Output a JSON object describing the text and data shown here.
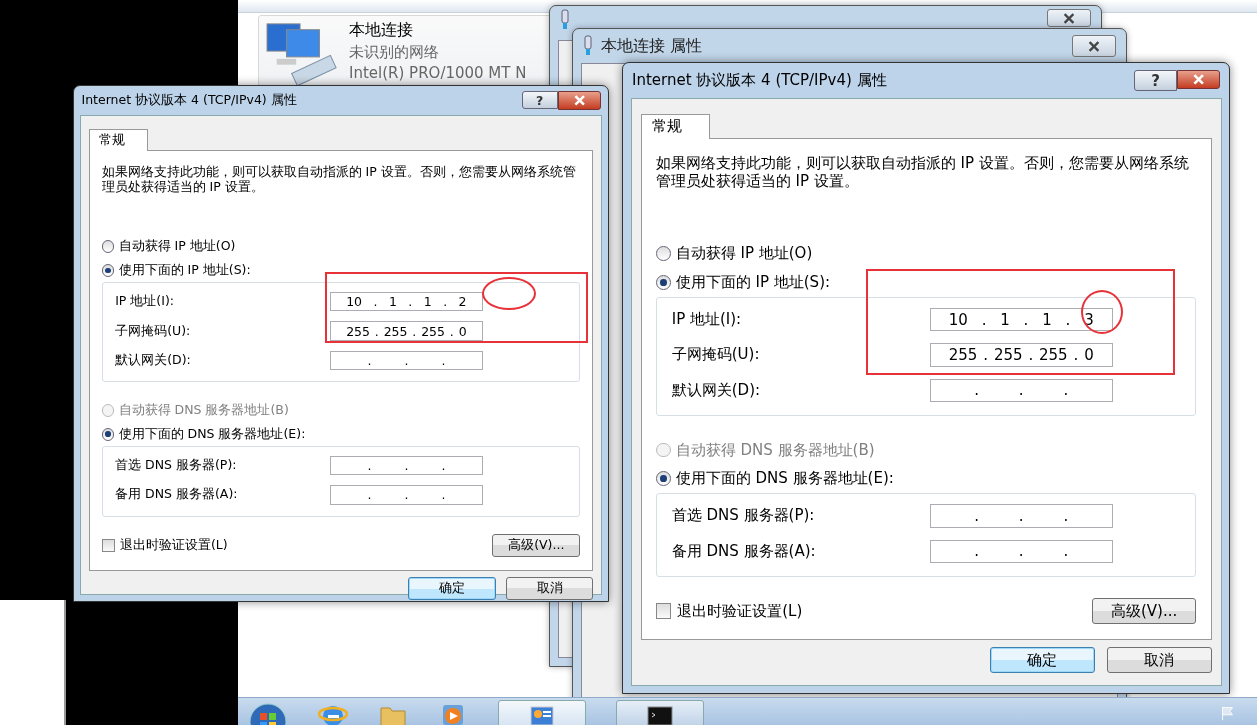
{
  "explorer": {
    "adapter": {
      "name": "本地连接",
      "status": "未识别的网络",
      "device": "Intel(R) PRO/1000 MT N"
    }
  },
  "background_windows": [
    {
      "title": "本地连接 属性"
    }
  ],
  "dialogs": [
    {
      "title": "Internet 协议版本 4 (TCP/IPv4) 属性",
      "help_button": "?",
      "tabs": [
        {
          "label": "常规",
          "selected": true
        }
      ],
      "description": "如果网络支持此功能，则可以获取自动指派的 IP 设置。否则，您需要从网络系统管理员处获得适当的 IP 设置。",
      "ip_options": [
        {
          "label": "自动获得 IP 地址(O)",
          "selected": false,
          "disabled": false
        },
        {
          "label": "使用下面的 IP 地址(S):",
          "selected": true,
          "disabled": false
        }
      ],
      "ip_fields": [
        {
          "label": "IP 地址(I):",
          "segments": [
            "10",
            ".",
            "1",
            ".",
            "1",
            ".",
            "2"
          ]
        },
        {
          "label": "子网掩码(U):",
          "segments": [
            "255",
            ".",
            "255",
            ".",
            "255",
            ".",
            "0"
          ]
        },
        {
          "label": "默认网关(D):",
          "segments": [
            ".",
            ".",
            "."
          ]
        }
      ],
      "dns_options": [
        {
          "label": "自动获得 DNS 服务器地址(B)",
          "selected": false,
          "disabled": true
        },
        {
          "label": "使用下面的 DNS 服务器地址(E):",
          "selected": true,
          "disabled": false
        }
      ],
      "dns_fields": [
        {
          "label": "首选 DNS 服务器(P):",
          "segments": [
            ".",
            ".",
            "."
          ]
        },
        {
          "label": "备用 DNS 服务器(A):",
          "segments": [
            ".",
            ".",
            "."
          ]
        }
      ],
      "validate": {
        "label": "退出时验证设置(L)",
        "checked": false
      },
      "advanced_button": "高级(V)...",
      "buttons": [
        {
          "label": "确定",
          "default": true
        },
        {
          "label": "取消",
          "default": false
        }
      ]
    },
    {
      "title": "Internet 协议版本 4 (TCP/IPv4) 属性",
      "help_button": "?",
      "tabs": [
        {
          "label": "常规",
          "selected": true
        }
      ],
      "description": "如果网络支持此功能，则可以获取自动指派的 IP 设置。否则，您需要从网络系统管理员处获得适当的 IP 设置。",
      "ip_options": [
        {
          "label": "自动获得 IP 地址(O)",
          "selected": false,
          "disabled": false
        },
        {
          "label": "使用下面的 IP 地址(S):",
          "selected": true,
          "disabled": false
        }
      ],
      "ip_fields": [
        {
          "label": "IP 地址(I):",
          "segments": [
            "10",
            ".",
            "1",
            ".",
            "1",
            ".",
            "3"
          ]
        },
        {
          "label": "子网掩码(U):",
          "segments": [
            "255",
            ".",
            "255",
            ".",
            "255",
            ".",
            "0"
          ]
        },
        {
          "label": "默认网关(D):",
          "segments": [
            ".",
            ".",
            "."
          ]
        }
      ],
      "dns_options": [
        {
          "label": "自动获得 DNS 服务器地址(B)",
          "selected": false,
          "disabled": true
        },
        {
          "label": "使用下面的 DNS 服务器地址(E):",
          "selected": true,
          "disabled": false
        }
      ],
      "dns_fields": [
        {
          "label": "首选 DNS 服务器(P):",
          "segments": [
            ".",
            ".",
            "."
          ]
        },
        {
          "label": "备用 DNS 服务器(A):",
          "segments": [
            ".",
            ".",
            "."
          ]
        }
      ],
      "validate": {
        "label": "退出时验证设置(L)",
        "checked": false
      },
      "advanced_button": "高级(V)...",
      "buttons": [
        {
          "label": "确定",
          "default": true
        },
        {
          "label": "取消",
          "default": false
        }
      ]
    }
  ],
  "taskbar": {
    "items": [
      {
        "kind": "start"
      },
      {
        "kind": "browser"
      },
      {
        "kind": "folder"
      },
      {
        "kind": "media"
      },
      {
        "kind": "network"
      },
      {
        "kind": "console"
      }
    ]
  }
}
